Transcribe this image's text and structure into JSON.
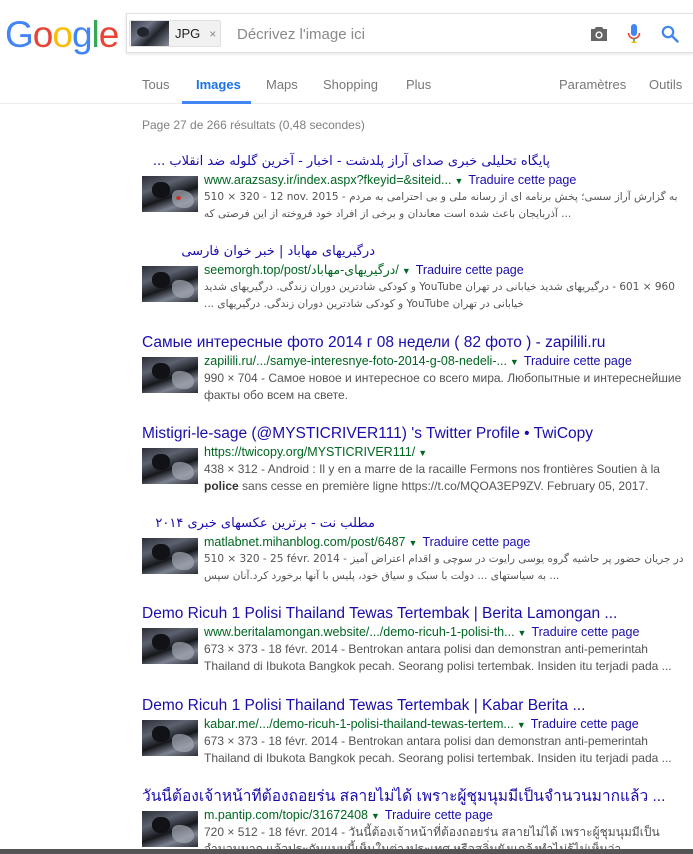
{
  "logo": {
    "letters": [
      "G",
      "o",
      "o",
      "g",
      "l",
      "e"
    ],
    "colors": [
      "#4285F4",
      "#EA4335",
      "#FBBC05",
      "#4285F4",
      "#34A853",
      "#EA4335"
    ]
  },
  "search": {
    "chip_label": "JPG",
    "chip_close": "×",
    "placeholder": "Décrivez l'image ici",
    "value": ""
  },
  "tabs": {
    "items": [
      "Tous",
      "Images",
      "Maps",
      "Shopping",
      "Plus"
    ],
    "active": "Images",
    "settings": "Paramètres",
    "tools": "Outils"
  },
  "stats": "Page 27 de 266 résultats (0,48 secondes)",
  "translate_label": "Traduire cette page",
  "results": [
    {
      "title": "پایگاه تحلیلی خبری صدای آراز پلدشت - اخبار - آخرین گلوله ضد انقلاب ...",
      "url": "www.arazsasy.ir/index.aspx?fkeyid=&siteid...",
      "meta": "510 × 320 - 12 nov. 2015",
      "snippet": "510 × 320 - 12 nov. 2015 - به گزارش آراز سسی؛ پخش برنامه ای از رسانه ملی و بی احترامی به مردم آذربایجان باعث شده است معاندان و برخی از افراد خود فروخته از این فرصتی که ..."
    },
    {
      "title": "درگیریهای مهاباد | خبر خوان فارسی",
      "url": "seemorgh.top/post/درگیریهای-مهاباد/",
      "meta": "960 × 601",
      "snippet": "960 × 601 - درگیریهای شدید خیابانی در تهران YouTube و کودکی شادترین دوران زندگی. درگیریهای شدید خیابانی در تهران YouTube و کودکی شادترین دوران زندگی. درگیریهای ..."
    },
    {
      "title": "Самые интересные фото 2014 г 08 недели ( 82 фото ) - zapilili.ru",
      "url": "zapilili.ru/.../samye-interesnye-foto-2014-g-08-nedeli-...",
      "meta": "990 × 704",
      "snippet": "990 × 704 - Самое новое и интересное со всего мира. Любопытные и интереснейшие факты обо всем на свете."
    },
    {
      "title": "Mistigri-le-sage (@MYSTICRIVER111) 's Twitter Profile • TwiCopy",
      "url": "https://twicopy.org/MYSTICRIVER111/",
      "meta": "438 × 312",
      "snippet_pre": "438 × 312 - Android : Il y en a marre de la racaille Fermons nos frontières Soutien à la ",
      "snippet_bold": "police",
      "snippet_post": " sans cesse en première ligne https://t.co/MQOA3EP9ZV. February 05, 2017."
    },
    {
      "title": "مطلب نت - برترین عکسهای خبری ۲۰۱۴",
      "url": "matlabnet.mihanblog.com/post/6487",
      "meta": "510 × 320 - 25 févr. 2014",
      "snippet": "510 × 320 - 25 févr. 2014 - در جریان حضور پر حاشیه گروه یوسی رایوت در سوچی و اقدام اعتراض آمیز به سیاستهای ... دولت با سبک و سیاق خود، پلیس با آنها برخورد کرد.آنان سپس ..."
    },
    {
      "title": "Demo Ricuh 1 Polisi Thailand Tewas Tertembak | Berita Lamongan ...",
      "url": "www.beritalamongan.website/.../demo-ricuh-1-polisi-th...",
      "meta": "673 × 373 - 18 févr. 2014",
      "snippet": "673 × 373 - 18 févr. 2014 - Bentrokan antara polisi dan demonstran anti-pemerintah Thailand di Ibukota Bangkok pecah. Seorang polisi tertembak. Insiden itu terjadi pada ..."
    },
    {
      "title": "Demo Ricuh 1 Polisi Thailand Tewas Tertembak | Kabar Berita ...",
      "url": "kabar.me/.../demo-ricuh-1-polisi-thailand-tewas-tertem...",
      "meta": "673 × 373 - 18 févr. 2014",
      "snippet": "673 × 373 - 18 févr. 2014 - Bentrokan antara polisi dan demonstran anti-pemerintah Thailand di Ibukota Bangkok pecah. Seorang polisi tertembak. Insiden itu terjadi pada ..."
    },
    {
      "title": "วันนี้ต้องเจ้าหน้าที่ต้องถอยร่น สลายไม่ได้ เพราะผู้ชุมนุมมีเป็นจำนวนมากแล้ว ...",
      "url": "m.pantip.com/topic/31672408",
      "meta": "720 × 512 - 18 févr. 2014",
      "snippet": "720 × 512 - 18 févr. 2014 - วันนี้ต้องเจ้าหน้าที่ต้องถอยร่น สลายไม่ได้ เพราะผู้ชุมนุมมีเป็นจำนวนมาก แล้วประกันแบบนี้เห็นในต่างประเทศ หรือสลิ่มยังแกล้งทำไม่รู้ไม่เห็นว่า ..."
    }
  ]
}
